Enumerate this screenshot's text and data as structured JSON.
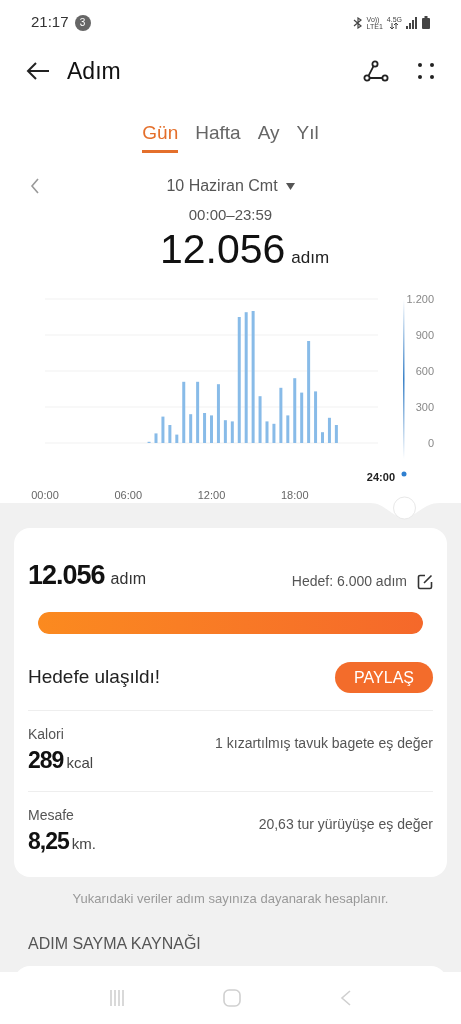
{
  "status_bar": {
    "time": "21:17",
    "notification_count": "3",
    "volte": "Vo))",
    "lte": "LTE1",
    "network": "4.5G"
  },
  "header": {
    "title": "Adım"
  },
  "tabs": [
    {
      "label": "Gün",
      "selected": true
    },
    {
      "label": "Hafta",
      "selected": false
    },
    {
      "label": "Ay",
      "selected": false
    },
    {
      "label": "Yıl",
      "selected": false
    }
  ],
  "date_picker": {
    "date": "10 Haziran Cmt",
    "range": "00:00–23:59",
    "total": "12.056",
    "unit": "adım"
  },
  "chart": {
    "chart_data": {
      "type": "bar",
      "x": [
        7.5,
        8,
        8.5,
        9,
        9.5,
        10,
        10.5,
        11,
        11.5,
        12,
        12.5,
        13,
        13.5,
        14,
        14.5,
        15,
        15.5,
        16,
        16.5,
        17,
        17.5,
        18,
        18.5,
        19,
        19.5,
        20,
        20.5,
        21
      ],
      "values": [
        10,
        80,
        220,
        150,
        70,
        510,
        240,
        510,
        250,
        230,
        490,
        190,
        180,
        1050,
        1090,
        1100,
        390,
        180,
        160,
        460,
        230,
        540,
        420,
        850,
        430,
        90,
        210,
        150
      ],
      "xlim": [
        0,
        24
      ],
      "ylim": [
        0,
        1200
      ],
      "grid": true,
      "xticks": [
        {
          "value": 0,
          "label": "00:00"
        },
        {
          "value": 6,
          "label": "06:00"
        },
        {
          "value": 12,
          "label": "12:00"
        },
        {
          "value": 18,
          "label": "18:00"
        }
      ],
      "yticks": [
        {
          "value": 0,
          "label": "0"
        },
        {
          "value": 300,
          "label": "300"
        },
        {
          "value": 600,
          "label": "600"
        },
        {
          "value": 900,
          "label": "900"
        },
        {
          "value": 1200,
          "label": "1.200"
        }
      ]
    },
    "cursor_label": "24:00"
  },
  "summary": {
    "steps": "12.056",
    "unit": "adım",
    "goal": "Hedef: 6.000 adım",
    "level": 1,
    "goal_message": "Hedefe ulaşıldı!",
    "share_button": "PAYLAŞ",
    "stats": [
      {
        "label": "Kalori",
        "value": "289",
        "unit": "kcal",
        "equivalent": "1 kızartılmış tavuk bagete eş değer"
      },
      {
        "label": "Mesafe",
        "value": "8,25",
        "unit": "km.",
        "equivalent": "20,63 tur yürüyüşe eş değer"
      }
    ]
  },
  "footnote": "Yukarıdaki veriler adım sayınıza dayanarak hesaplanır.",
  "source_section": {
    "title": "ADIM SAYMA KAYNAĞI"
  }
}
